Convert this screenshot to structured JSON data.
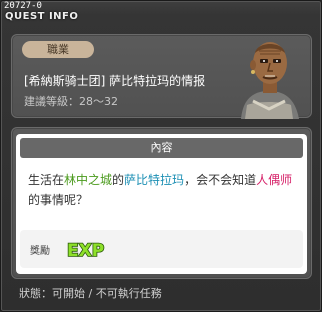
{
  "window": {
    "quest_id": "20727-0",
    "title": "QUEST INFO"
  },
  "header": {
    "badge": "職業",
    "quest_name": "[希納斯骑士团] 萨比特拉玛的情报",
    "level_label": "建議等級：",
    "level_range": "28～32"
  },
  "content": {
    "section_title": "內容",
    "desc": {
      "p1": "生活在",
      "place": "林中之城",
      "p2": "的",
      "npc": "萨比特拉玛",
      "p3": "，会不会知道",
      "job": "人偶师",
      "p4": "的事情呢？"
    },
    "reward_label": "獎勵",
    "reward_icon": "exp-icon",
    "reward_icon_text": "EXP"
  },
  "status": {
    "text": "狀態：可開始 / 不可執行任務"
  },
  "colors": {
    "place": "#4a9a1c",
    "npc": "#1c8fb4",
    "job": "#d62068",
    "exp": "#8ee02a"
  }
}
